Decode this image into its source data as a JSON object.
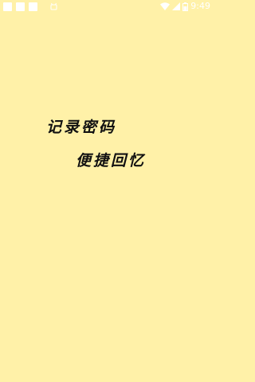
{
  "status_bar": {
    "time": "9:49",
    "icons": [
      "app-notification-icon",
      "app-notification-icon",
      "app-notification-icon",
      "android-notification-icon",
      "wifi-icon",
      "signal-icon",
      "battery-icon"
    ]
  },
  "splash": {
    "line1": "记录密码",
    "line2": "便捷回忆"
  },
  "colors": {
    "background": "#fff1a8",
    "text": "#111111",
    "status_icons": "#ffffff"
  }
}
